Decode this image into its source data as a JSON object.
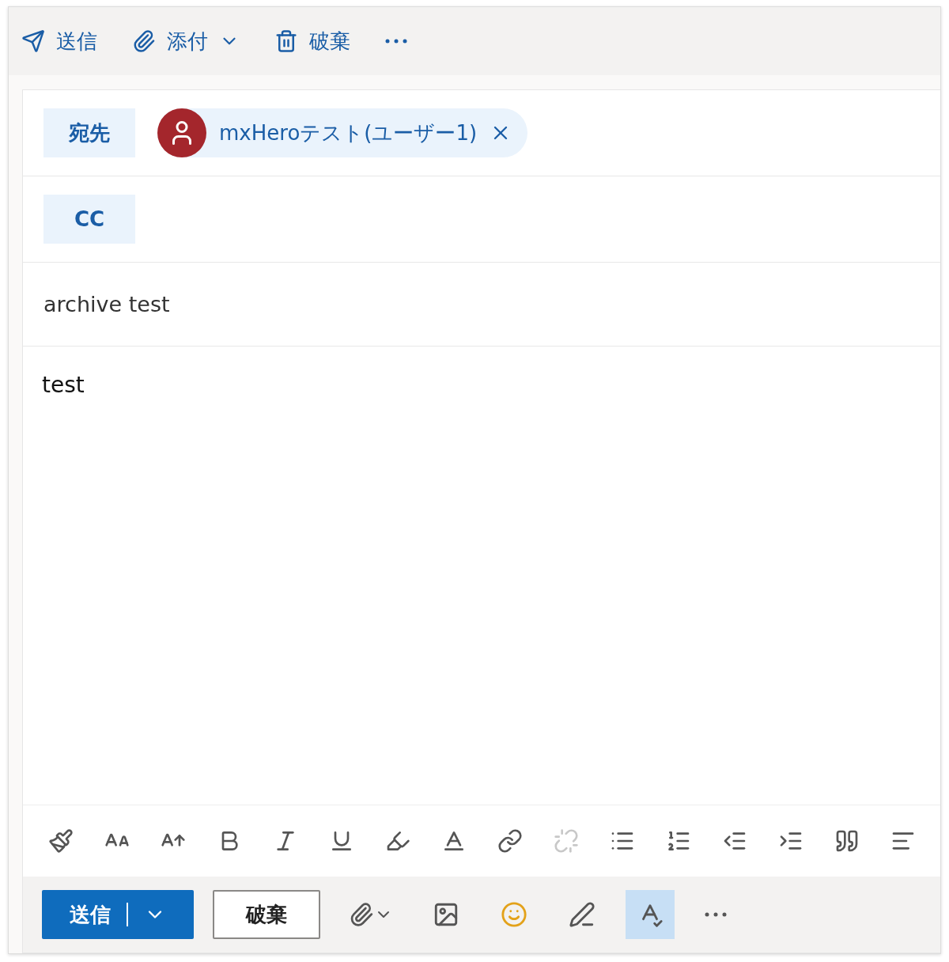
{
  "toolbar": {
    "send": "送信",
    "attach": "添付",
    "discard": "破棄"
  },
  "to": {
    "label": "宛先",
    "recipients": [
      {
        "name": "mxHeroテスト(ユーザー1)"
      }
    ]
  },
  "cc": {
    "label": "CC"
  },
  "subject": {
    "value": "archive test"
  },
  "body": {
    "value": "test"
  },
  "format_tools": [
    {
      "disabled": false
    },
    {
      "disabled": false
    },
    {
      "disabled": false
    },
    {
      "disabled": false
    },
    {
      "disabled": false
    },
    {
      "disabled": false
    },
    {
      "disabled": false
    },
    {
      "disabled": false
    },
    {
      "disabled": false
    },
    {
      "disabled": true
    },
    {
      "disabled": false
    },
    {
      "disabled": false
    },
    {
      "disabled": false
    },
    {
      "disabled": false
    },
    {
      "disabled": false
    },
    {
      "disabled": false
    }
  ],
  "footer": {
    "send": "送信",
    "discard": "破棄",
    "tools": [
      {
        "selected": false
      },
      {
        "selected": false
      },
      {
        "selected": false
      },
      {
        "selected": true
      }
    ]
  }
}
